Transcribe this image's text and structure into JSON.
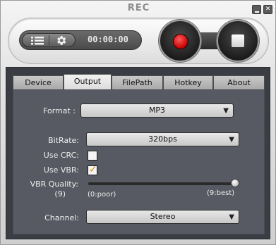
{
  "window": {
    "title": "REC"
  },
  "controls": {
    "timer": "00:00:00"
  },
  "tabs": [
    {
      "label": "Device",
      "active": false
    },
    {
      "label": "Output",
      "active": true
    },
    {
      "label": "FilePath",
      "active": false
    },
    {
      "label": "Hotkey",
      "active": false
    },
    {
      "label": "About",
      "active": false
    }
  ],
  "output": {
    "format_label": "Format :",
    "format_value": "MP3",
    "bitrate_label": "BitRate:",
    "bitrate_value": "320bps",
    "crc_label": "Use CRC:",
    "crc_checked": false,
    "vbr_label": "Use VBR:",
    "vbr_checked": true,
    "vbr_quality_label": "VBR Quality:",
    "vbr_quality_value": "(9)",
    "vbr_quality_level": 9,
    "slider_min_label": "(0:poor)",
    "slider_max_label": "(9:best)",
    "channel_label": "Channel:",
    "channel_value": "Stereo"
  },
  "colors": {
    "accent_record": "#c40000",
    "panel_dark": "#3b3d44",
    "content_bg": "#575a62",
    "check_mark": "#d98b00"
  }
}
